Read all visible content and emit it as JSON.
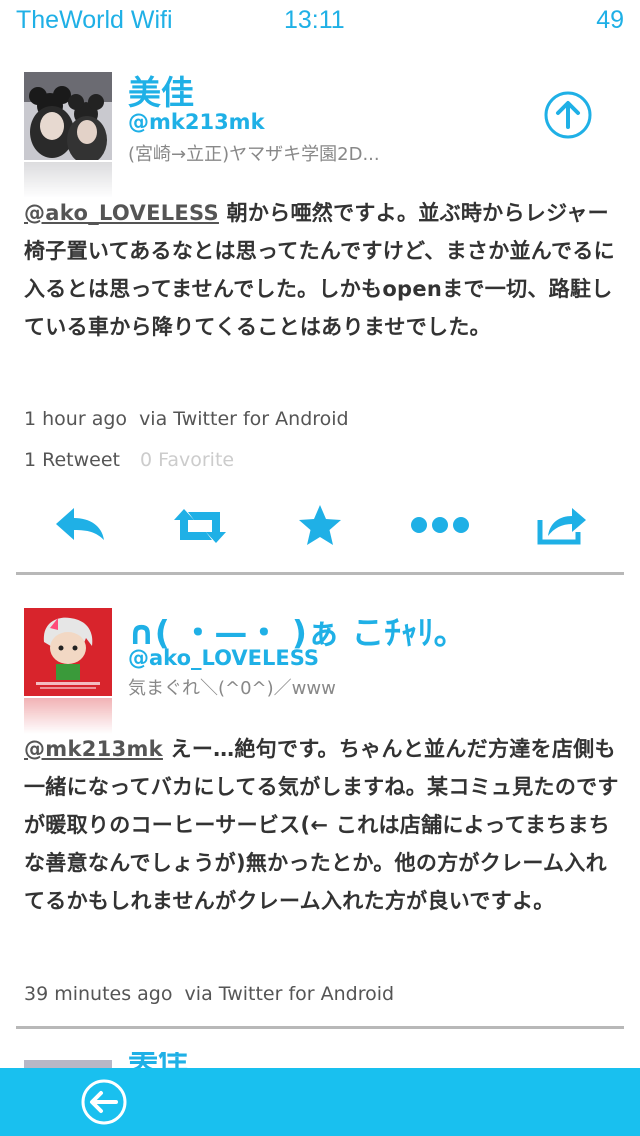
{
  "status_bar": {
    "carrier": "TheWorld Wifi",
    "time": "13:11",
    "battery": "49"
  },
  "tweets": [
    {
      "name": "美佳",
      "handle": "@mk213mk",
      "bio": "(宮崎→立正)ヤマザキ学園2D...",
      "mention": "@ako_LOVELESS",
      "text": " 朝から唖然ですよ。並ぶ時からレジャー椅子置いてあるなとは思ってたんですけど、まさか並んでるに入るとは思ってませんでした。しかもopenまで一切、路駐している車から降りてくることはありませでした。",
      "time": "1 hour ago",
      "via": "via Twitter for Android",
      "retweets": "1 Retweet",
      "favorites": "0 Favorite"
    },
    {
      "name": "∩( ・—・ )ぁ こﾁｬﾘ｡",
      "handle": "@ako_LOVELESS",
      "bio": "気まぐれ＼(^0^)／www",
      "mention": "@mk213mk",
      "text": " えー…絶句です。ちゃんと並んだ方達を店側も一緒になってバカにしてる気がしますね。某コミュ見たのですが暖取りのコーヒーサービス(← これは店舗によってまちまちな善意なんでしょうが)無かったとか。他の方がクレーム入れてるかもしれませんがクレーム入れた方が良いですよ。",
      "time": "39 minutes ago",
      "via": "via Twitter for Android"
    }
  ],
  "icons": {
    "scroll_top": "arrow-up-circle-icon",
    "reply": "reply-icon",
    "retweet": "retweet-icon",
    "favorite": "star-icon",
    "more": "more-icon",
    "share": "share-icon",
    "back": "back-arrow-circle-icon"
  },
  "colors": {
    "accent": "#1fb0e6",
    "bottom_bar": "#19c0ef",
    "divider": "#b8b8b8"
  }
}
